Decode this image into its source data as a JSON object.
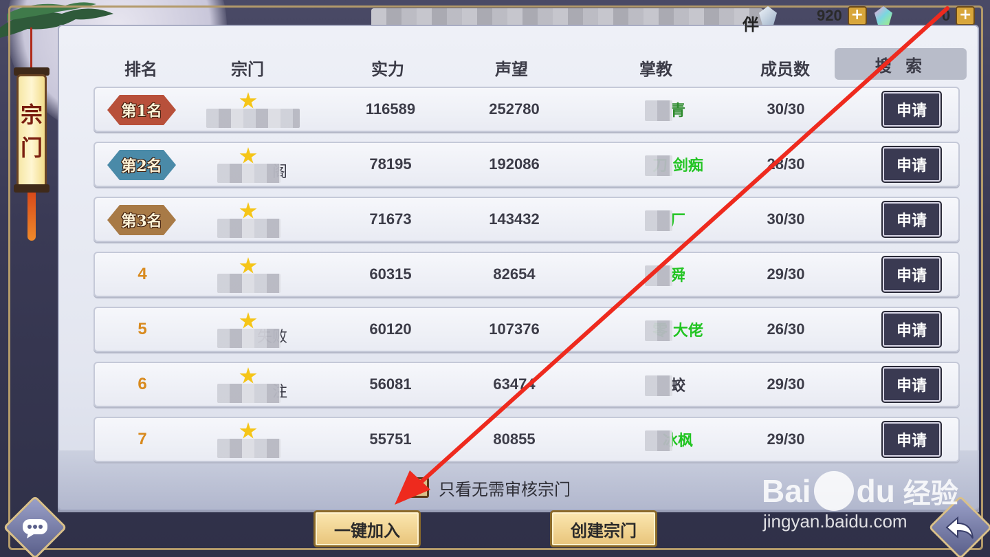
{
  "announcement": {
    "visible_text": "伴",
    "obscured": true
  },
  "currency": [
    {
      "icon": "silver-gem-icon",
      "value": "920",
      "color": "#c9d6e6"
    },
    {
      "icon": "rainbow-crystal-icon",
      "value": "0",
      "color": "#7ad6e0"
    }
  ],
  "side_tab": {
    "chars": [
      "宗",
      "门"
    ]
  },
  "headers": {
    "rank": "排名",
    "sect": "宗门",
    "power": "实力",
    "prestige": "声望",
    "leader": "掌教",
    "members": "成员数",
    "search": "搜 索"
  },
  "rows": [
    {
      "rank": "1",
      "badge": "第1名",
      "badge_color": "#b8503a",
      "sect": "",
      "power": "116589",
      "prestige": "252780",
      "leader": "青",
      "leader_color": "#2c8a2c",
      "members": "30/30",
      "apply": "申请"
    },
    {
      "rank": "2",
      "badge": "第2名",
      "badge_color": "#4a8aa8",
      "sect": "阁",
      "power": "78195",
      "prestige": "192086",
      "leader": "刀 剑痴",
      "leader_color": "#22c422",
      "members": "28/30",
      "apply": "申请"
    },
    {
      "rank": "3",
      "badge": "第3名",
      "badge_color": "#a87a46",
      "sect": "",
      "power": "71673",
      "prestige": "143432",
      "leader": "厂",
      "leader_color": "#22c422",
      "members": "30/30",
      "apply": "申请"
    },
    {
      "rank": "4",
      "badge": "",
      "badge_color": "",
      "sect": "",
      "power": "60315",
      "prestige": "82654",
      "leader": "舜",
      "leader_color": "#22c422",
      "members": "29/30",
      "apply": "申请"
    },
    {
      "rank": "5",
      "badge": "",
      "badge_color": "",
      "sect": "失败",
      "power": "60120",
      "prestige": "107376",
      "leader": "零 大佬",
      "leader_color": "#22c422",
      "members": "26/30",
      "apply": "申请"
    },
    {
      "rank": "6",
      "badge": "",
      "badge_color": "",
      "sect": "注",
      "power": "56081",
      "prestige": "63474",
      "leader": "蛟",
      "leader_color": "#3c3c48",
      "members": "29/30",
      "apply": "申请"
    },
    {
      "rank": "7",
      "badge": "",
      "badge_color": "",
      "sect": "",
      "power": "55751",
      "prestige": "80855",
      "leader": "冰枫",
      "leader_color": "#22c422",
      "members": "29/30",
      "apply": "申请"
    }
  ],
  "filter": {
    "label": "只看无需审核宗门",
    "checked": false
  },
  "buttons": {
    "join": "一键加入",
    "create": "创建宗门"
  },
  "corner_buttons": {
    "left_icon": "chat-bubble-icon",
    "right_icon": "back-arrow-icon"
  },
  "watermark": {
    "main": "Bai",
    "main2": "du",
    "brand": "经验",
    "url": "jingyan.baidu.com"
  },
  "colors": {
    "accent_gold": "#d8a63b",
    "apply_bg": "#3a3a52",
    "rank_orange": "#d88a1e",
    "annotation_arrow": "#ee2a1e"
  }
}
